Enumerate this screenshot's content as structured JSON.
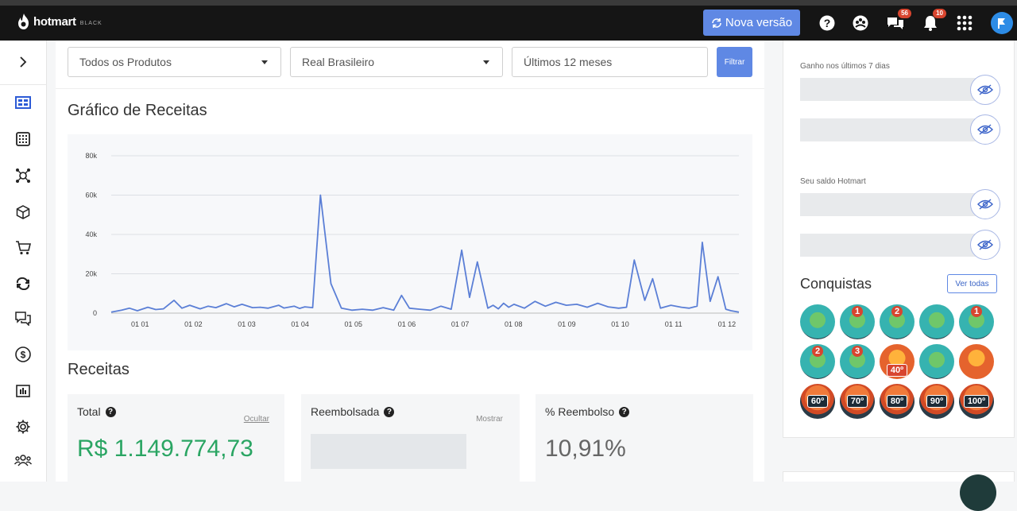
{
  "header": {
    "logo": "hotmart",
    "logo_sub": "BLACK",
    "new_version_label": "Nova versão",
    "messages_badge": "56",
    "notifications_badge": "10"
  },
  "filters": {
    "product": "Todos os Produtos",
    "currency": "Real Brasileiro",
    "period": "Últimos 12 meses",
    "filter_button": "Filtrar"
  },
  "revenue_chart_title": "Gráfico de Receitas",
  "chart_data": {
    "type": "line",
    "title": "Gráfico de Receitas",
    "xlabel": "",
    "ylabel": "",
    "ylim": [
      0,
      80000
    ],
    "y_ticks": [
      "0",
      "20k",
      "40k",
      "60k",
      "80k"
    ],
    "x_ticks": [
      "01 01",
      "01 02",
      "01 03",
      "01 04",
      "01 05",
      "01 06",
      "01 07",
      "01 08",
      "01 09",
      "01 10",
      "01 11",
      "01 12"
    ],
    "grid": true,
    "color": "#5b7fd6",
    "series": [
      {
        "x": [
          0.0,
          0.2,
          0.35,
          0.5,
          0.7,
          0.85,
          1.0,
          1.2,
          1.35,
          1.5,
          1.7,
          1.85,
          2.0,
          2.2,
          2.35,
          2.5,
          2.7,
          2.85,
          3.0,
          3.2,
          3.3,
          3.5,
          3.6,
          3.7,
          3.85,
          4.0,
          4.2,
          4.4,
          4.6,
          4.8,
          5.0,
          5.2,
          5.4,
          5.55,
          5.7,
          5.9,
          6.1,
          6.3,
          6.5,
          6.7,
          6.85,
          7.0,
          7.2,
          7.3,
          7.4,
          7.5,
          7.6,
          7.7,
          7.9,
          8.1,
          8.3,
          8.5,
          8.7,
          8.9,
          9.1,
          9.3,
          9.5,
          9.7,
          9.85,
          10.0,
          10.2,
          10.35,
          10.5,
          10.7,
          10.9,
          11.05,
          11.2,
          11.3,
          11.45,
          11.6,
          11.75,
          11.85,
          12.0
        ],
        "y": [
          500,
          1500,
          2500,
          1200,
          3000,
          1800,
          2200,
          6500,
          2500,
          4000,
          2200,
          3500,
          2800,
          4800,
          3200,
          4500,
          2800,
          3000,
          2500,
          4000,
          2600,
          3500,
          2400,
          3200,
          2800,
          60000,
          15000,
          2500,
          1500,
          2000,
          1500,
          2800,
          1500,
          9000,
          2500,
          2000,
          1500,
          3500,
          2000,
          32000,
          8000,
          26000,
          2500,
          4000,
          2200,
          5000,
          3000,
          4500,
          2500,
          6000,
          3500,
          5500,
          4000,
          4500,
          3000,
          5000,
          3200,
          2500,
          3000,
          27000,
          6500,
          17500,
          2500,
          4000,
          3000,
          2500,
          3500,
          36000,
          6000,
          18500,
          2000,
          1200,
          500
        ]
      }
    ]
  },
  "revenue_section_title": "Receitas",
  "cards": {
    "total": {
      "label": "Total",
      "link": "Ocultar",
      "value": "R$ 1.149.774,73"
    },
    "refunded": {
      "label": "Reembolsada",
      "link": "Mostrar"
    },
    "refund_pct": {
      "label": "% Reembolso",
      "value": "10,91%"
    }
  },
  "right_panel": {
    "earnings_label": "Ganho nos últimos 7 dias",
    "balance_label": "Seu saldo Hotmart",
    "achievements_title": "Conquistas",
    "see_all": "Ver todas",
    "achievements": [
      {
        "icon": "certificate-badge",
        "label": ""
      },
      {
        "icon": "android-badge",
        "label": "1"
      },
      {
        "icon": "android-badge",
        "label": "2"
      },
      {
        "icon": "trophy-badge",
        "label": ""
      },
      {
        "icon": "android-badge",
        "label": "1"
      },
      {
        "icon": "android-badge",
        "label": "2"
      },
      {
        "icon": "android-badge",
        "label": "3"
      },
      {
        "icon": "sun-badge",
        "label": "40º"
      },
      {
        "icon": "ninja-badge",
        "label": ""
      },
      {
        "icon": "volcano-badge",
        "label": ""
      },
      {
        "icon": "temperature-badge",
        "label": "60º"
      },
      {
        "icon": "temperature-badge",
        "label": "70º"
      },
      {
        "icon": "temperature-badge",
        "label": "80º"
      },
      {
        "icon": "temperature-badge",
        "label": "90º"
      },
      {
        "icon": "temperature-badge",
        "label": "100º"
      }
    ]
  }
}
